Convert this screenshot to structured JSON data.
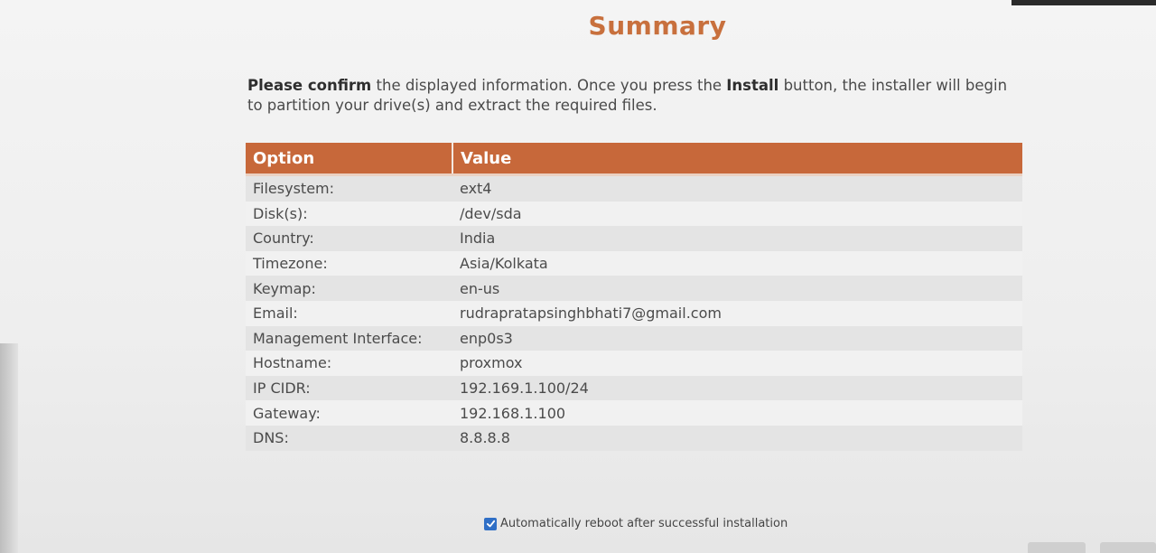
{
  "title": "Summary",
  "intro": {
    "bold_start": "Please confirm",
    "text_1": " the displayed information. Once you press the ",
    "bold_mid": "Install",
    "text_2": " button, the installer will begin to partition your drive(s) and extract the required files."
  },
  "table": {
    "headers": {
      "option": "Option",
      "value": "Value"
    },
    "rows": [
      {
        "option": "Filesystem:",
        "value": "ext4"
      },
      {
        "option": "Disk(s):",
        "value": "/dev/sda"
      },
      {
        "option": "Country:",
        "value": "India"
      },
      {
        "option": "Timezone:",
        "value": "Asia/Kolkata"
      },
      {
        "option": "Keymap:",
        "value": "en-us"
      },
      {
        "option": "Email:",
        "value": "rudrapratapsinghbhati7@gmail.com"
      },
      {
        "option": "Management Interface:",
        "value": "enp0s3"
      },
      {
        "option": "Hostname:",
        "value": "proxmox"
      },
      {
        "option": "IP CIDR:",
        "value": "192.169.1.100/24"
      },
      {
        "option": "Gateway:",
        "value": "192.168.1.100"
      },
      {
        "option": "DNS:",
        "value": "8.8.8.8"
      }
    ]
  },
  "reboot": {
    "label": "Automatically reboot after successful installation",
    "checked": true
  },
  "colors": {
    "accent": "#c7683a",
    "checkbox": "#2f6fc6"
  }
}
